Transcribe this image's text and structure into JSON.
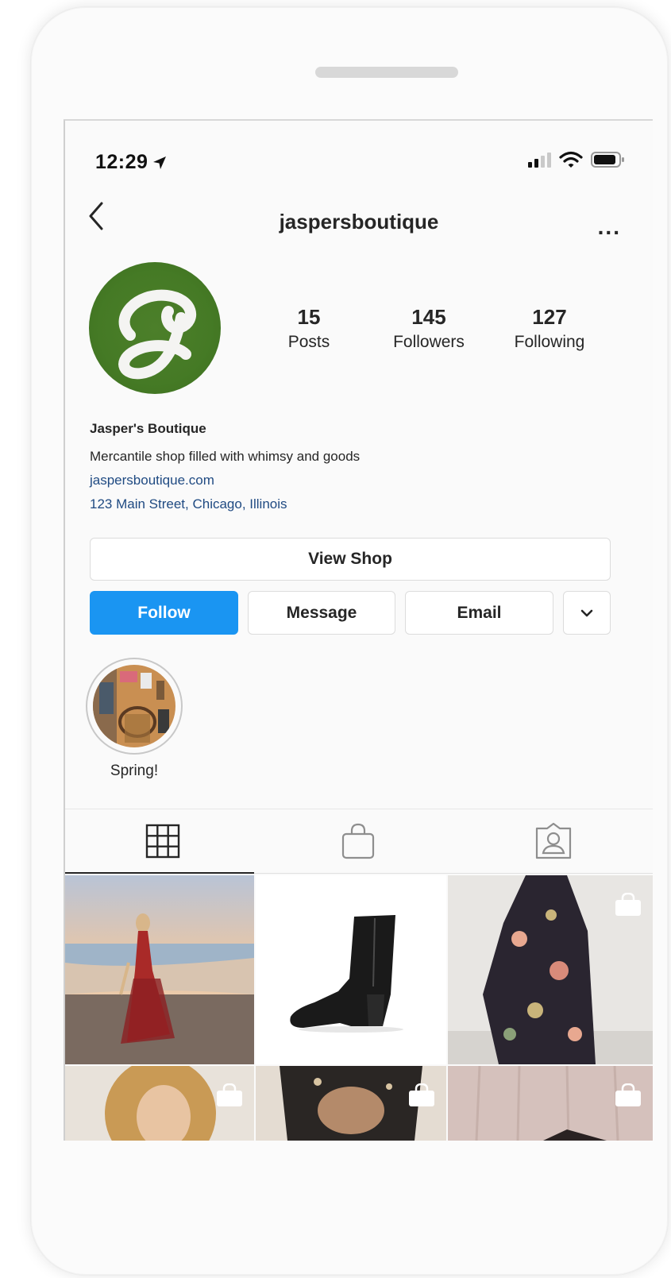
{
  "status_bar": {
    "time": "12:29"
  },
  "header": {
    "username": "jaspersboutique",
    "more_label": "..."
  },
  "profile": {
    "stats": [
      {
        "value": "15",
        "label": "Posts"
      },
      {
        "value": "145",
        "label": "Followers"
      },
      {
        "value": "127",
        "label": "Following"
      }
    ],
    "display_name": "Jasper's Boutique",
    "bio": "Mercantile shop filled with whimsy and goods",
    "website": "jaspersboutique.com",
    "address": "123 Main Street, Chicago, Illinois"
  },
  "actions": {
    "view_shop": "View Shop",
    "follow": "Follow",
    "message": "Message",
    "email": "Email"
  },
  "highlights": [
    {
      "label": "Spring!"
    }
  ],
  "tabs": {
    "active": "grid",
    "items": [
      "grid-icon",
      "shopping-bag-icon",
      "tagged-person-icon"
    ]
  },
  "colors": {
    "follow_blue": "#1a95f2",
    "link_blue": "#1f4a82",
    "avatar_green": "#457a25"
  }
}
